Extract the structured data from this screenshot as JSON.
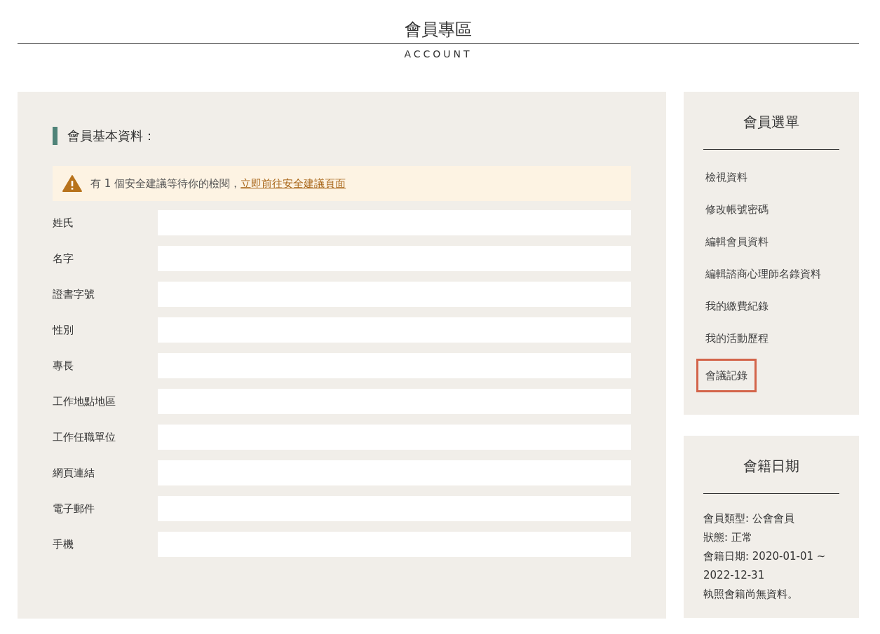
{
  "header": {
    "title": "會員專區",
    "subtitle": "ACCOUNT"
  },
  "profile": {
    "heading": "會員基本資料：",
    "alert": {
      "text": "有 1 個安全建議等待你的檢閱，",
      "link": "立即前往安全建議頁面"
    },
    "fields": [
      {
        "label": "姓氏"
      },
      {
        "label": "名字"
      },
      {
        "label": "證書字號"
      },
      {
        "label": "性別"
      },
      {
        "label": "專長"
      },
      {
        "label": "工作地點地區"
      },
      {
        "label": "工作任職單位"
      },
      {
        "label": "網頁連結"
      },
      {
        "label": "電子郵件"
      },
      {
        "label": "手機"
      }
    ]
  },
  "menu": {
    "title": "會員選單",
    "items": [
      {
        "label": "檢視資料",
        "selected": false
      },
      {
        "label": "修改帳號密碼",
        "selected": false
      },
      {
        "label": "編輯會員資料",
        "selected": false
      },
      {
        "label": "編輯諮商心理師名錄資料",
        "selected": false
      },
      {
        "label": "我的繳費紀錄",
        "selected": false
      },
      {
        "label": "我的活動歷程",
        "selected": false
      },
      {
        "label": "會議記錄",
        "selected": true
      }
    ]
  },
  "membership": {
    "title": "會籍日期",
    "lines": [
      "會員類型: 公會會員",
      "狀態: 正常",
      "會籍日期: 2020-01-01 ~ 2022-12-31",
      "執照會籍尚無資料。"
    ]
  }
}
